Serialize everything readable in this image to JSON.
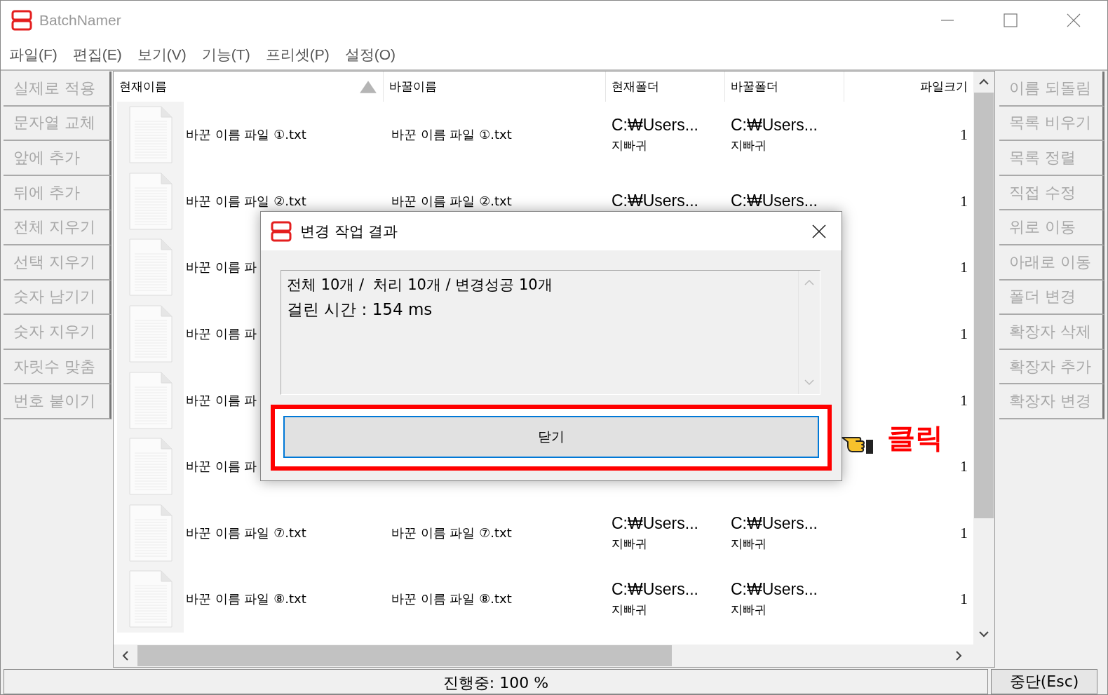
{
  "window": {
    "title": "BatchNamer"
  },
  "menu": [
    "파일(F)",
    "편집(E)",
    "보기(V)",
    "기능(T)",
    "프리셋(P)",
    "설정(O)"
  ],
  "left_buttons": [
    {
      "label": "실제로 적용",
      "disabled": true
    },
    {
      "label": "문자열 교체",
      "disabled": true
    },
    {
      "label": "앞에 추가",
      "disabled": true
    },
    {
      "label": "뒤에 추가",
      "disabled": true
    },
    {
      "label": "전체 지우기",
      "disabled": true
    },
    {
      "label": "선택 지우기",
      "disabled": true
    },
    {
      "label": "숫자 남기기",
      "disabled": true
    },
    {
      "label": "숫자 지우기",
      "disabled": true
    },
    {
      "label": "자릿수 맞춤",
      "disabled": true
    },
    {
      "label": "번호 붙이기",
      "disabled": true
    }
  ],
  "columns": [
    {
      "label": "현재이름",
      "sorted": true
    },
    {
      "label": "바꿀이름",
      "sorted": false
    },
    {
      "label": "현재폴더",
      "sorted": false
    },
    {
      "label": "바꿀폴더",
      "sorted": false
    },
    {
      "label": "파일크기",
      "sorted": false
    }
  ],
  "rows": [
    {
      "current_name": "바꾼 이름 파일 ①.txt",
      "new_name": "바꾼 이름 파일 ①.txt",
      "current_folder": "C:₩Users...",
      "current_folder_sub": "지빠귀",
      "new_folder": "C:₩Users...",
      "new_folder_sub": "지빠귀",
      "size": "1"
    },
    {
      "current_name": "바꾼 이름 파일 ②.txt",
      "new_name": "바꾼 이름 파일 ②.txt",
      "current_folder": "C:₩Users...",
      "new_folder": "C:₩Users...",
      "size": "1"
    },
    {
      "current_name": "바꾼 이름 파",
      "size": "1"
    },
    {
      "current_name": "바꾼 이름 파",
      "size": "1"
    },
    {
      "current_name": "바꾼 이름 파",
      "size": "1"
    },
    {
      "current_name": "바꾼 이름 파",
      "size": "1"
    },
    {
      "current_name": "바꾼 이름 파일 ⑦.txt",
      "new_name": "바꾼 이름 파일 ⑦.txt",
      "current_folder": "C:₩Users...",
      "current_folder_sub": "지빠귀",
      "new_folder": "C:₩Users...",
      "new_folder_sub": "지빠귀",
      "size": "1"
    },
    {
      "current_name": "바꾼 이름 파일 ⑧.txt",
      "new_name": "바꾼 이름 파일 ⑧.txt",
      "current_folder": "C:₩Users...",
      "current_folder_sub": "지빠귀",
      "new_folder": "C:₩Users...",
      "new_folder_sub": "지빠귀",
      "size": "1"
    }
  ],
  "right_buttons": [
    {
      "label": "이름 되돌림",
      "disabled": true
    },
    {
      "label": "목록 비우기",
      "disabled": true
    },
    {
      "label": "목록 정렬",
      "disabled": true
    },
    {
      "label": "직접 수정",
      "disabled": true
    },
    {
      "label": "위로 이동",
      "disabled": true
    },
    {
      "label": "아래로 이동",
      "disabled": true
    },
    {
      "label": "폴더 변경",
      "disabled": true
    },
    {
      "label": "확장자 삭제",
      "disabled": true
    },
    {
      "label": "확장자 추가",
      "disabled": true
    },
    {
      "label": "확장자 변경",
      "disabled": true
    }
  ],
  "status": {
    "progress": "진행중: 100 %",
    "stop_button": "중단(Esc)"
  },
  "dialog": {
    "title": "변경 작업 결과",
    "lines": [
      "전체 10개 /  처리 10개 / 변경성공 10개",
      "걸린 시간 : 154 ms"
    ],
    "close_button": "닫기",
    "highlighted": true,
    "callout": "클릭"
  }
}
